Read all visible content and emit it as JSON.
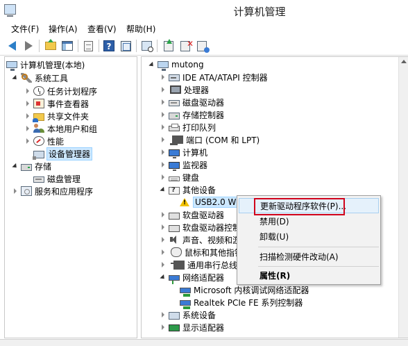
{
  "window": {
    "title": "计算机管理"
  },
  "menu": [
    {
      "label": "文件(F)"
    },
    {
      "label": "操作(A)"
    },
    {
      "label": "查看(V)"
    },
    {
      "label": "帮助(H)"
    }
  ],
  "toolbar": {
    "icons": [
      "back-icon",
      "forward-icon",
      "up-folder-icon",
      "show-hide-tree-icon",
      "export-list-icon",
      "help-icon",
      "properties-pane-icon",
      "scan-hardware-icon",
      "update-driver-icon",
      "uninstall-device-icon",
      "disable-device-icon"
    ]
  },
  "left_tree": {
    "root": "计算机管理(本地)",
    "system_tools": "系统工具",
    "task_scheduler": "任务计划程序",
    "event_viewer": "事件查看器",
    "shared_folders": "共享文件夹",
    "local_users_groups": "本地用户和组",
    "performance": "性能",
    "device_manager": "设备管理器",
    "storage": "存储",
    "disk_management": "磁盘管理",
    "services_apps": "服务和应用程序"
  },
  "device_tree": {
    "root": "mutong",
    "ide": "IDE ATA/ATAPI 控制器",
    "processor": "处理器",
    "disk_drives": "磁盘驱动器",
    "storage_ctrl": "存储控制器",
    "print_queue": "打印队列",
    "ports": "端口 (COM 和 LPT)",
    "computer": "计算机",
    "monitors": "监视器",
    "keyboards": "键盘",
    "other_devices": "其他设备",
    "usb_device": "USB2.0 W",
    "floppy_drive": "软盘驱动器",
    "floppy_ctrl": "软盘驱动器控制",
    "sound": "声音、视频和游",
    "mouse": "鼠标和其他指针",
    "usb_bus": "通用串行总线控",
    "network_adapters": "网络适配器",
    "nic_microsoft": "Microsoft 内核调试网络适配器",
    "nic_realtek": "Realtek PCIe FE 系列控制器",
    "system_devices": "系统设备",
    "display_adapters": "显示适配器"
  },
  "context_menu": {
    "update_driver": "更新驱动程序软件(P)...",
    "disable": "禁用(D)",
    "uninstall": "卸载(U)",
    "scan": "扫描检测硬件改动(A)",
    "properties": "属性(R)"
  },
  "colors": {
    "highlight_box": "#d0021b",
    "menu_hover": "#e5f1fb",
    "selected_node": "#cde8ff"
  }
}
